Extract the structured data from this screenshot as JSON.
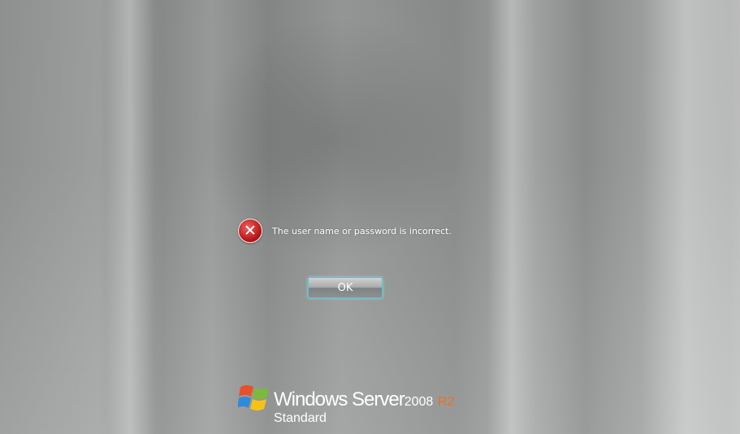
{
  "dialog": {
    "icon": "error-icon",
    "message": "The user name or password is incorrect.",
    "ok_label": "OK",
    "accent_color": "#4fc9cc"
  },
  "branding": {
    "product": "Windows Server",
    "version": "2008",
    "release": "R2",
    "edition": "Standard",
    "release_color": "#e8702a"
  }
}
